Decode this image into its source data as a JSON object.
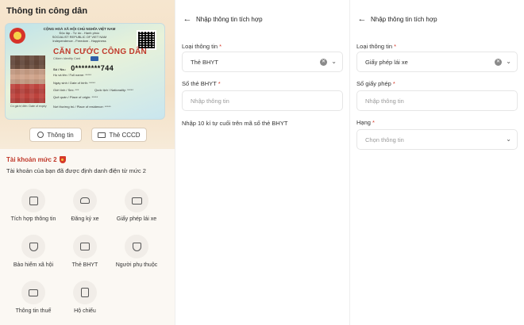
{
  "left": {
    "title": "Thông tin công dân",
    "card": {
      "hdr1": "CỘNG HOÀ XÃ HỘI CHỦ NGHĨA VIỆT NAM",
      "hdr2": "Độc lập - Tự do - Hạnh phúc",
      "hdr3": "SOCIALIST REPUBLIC OF VIET NAM",
      "hdr4": "Independence - Freedom - Happiness",
      "title": "CĂN CƯỚC CÔNG DÂN",
      "subtitle": "Citizen Identity Card",
      "number_label": "Số / No.:",
      "number": "0********744",
      "name": "Họ và tên / Full name:  *****",
      "dob": "Ngày sinh / Date of birth:  *****",
      "sex": "Giới tính / Sex:  ***",
      "nationality": "Quốc tịch / Nationality:  *****",
      "origin": "Quê quán / Place of origin:  *****",
      "residence": "Nơi thường trú / Place of residence:  *****",
      "photo_caption": "Có giá trị đến: Date of expiry"
    },
    "tabs": {
      "info": "Thông tin",
      "cccd": "Thẻ CCCD"
    },
    "account": {
      "title": "Tài khoản mức 2",
      "desc": "Tài khoản của bạn đã được định danh điện tử mức 2"
    },
    "services": [
      {
        "label": "Tích hợp thông tin",
        "icon": "document-plus-icon"
      },
      {
        "label": "Đăng ký xe",
        "icon": "car-icon"
      },
      {
        "label": "Giấy phép lái xe",
        "icon": "license-card-icon"
      },
      {
        "label": "Bảo hiểm xã hội",
        "icon": "shield-plus-icon"
      },
      {
        "label": "Thẻ BHYT",
        "icon": "health-card-icon"
      },
      {
        "label": "Người phụ thuộc",
        "icon": "person-shield-icon"
      },
      {
        "label": "Thông tin thuế",
        "icon": "tax-card-icon"
      },
      {
        "label": "Hộ chiếu",
        "icon": "passport-icon"
      }
    ]
  },
  "middle": {
    "header": "Nhập thông tin tích hợp",
    "type_label": "Loại thông tin",
    "type_value": "Thẻ BHYT",
    "number_label": "Số thẻ BHYT",
    "number_placeholder": "Nhập thông tin",
    "hint": "Nhập 10 kí tự cuối trên mã số thẻ BHYT"
  },
  "right": {
    "header": "Nhập thông tin tích hợp",
    "type_label": "Loại thông tin",
    "type_value": "Giấy phép lái xe",
    "license_label": "Số giấy phép",
    "license_placeholder": "Nhập thông tin",
    "rank_label": "Hạng",
    "rank_placeholder": "Chọn thông tin"
  },
  "colors": {
    "accent": "#d63a2a",
    "panel_bg": "#fbf8f3"
  }
}
